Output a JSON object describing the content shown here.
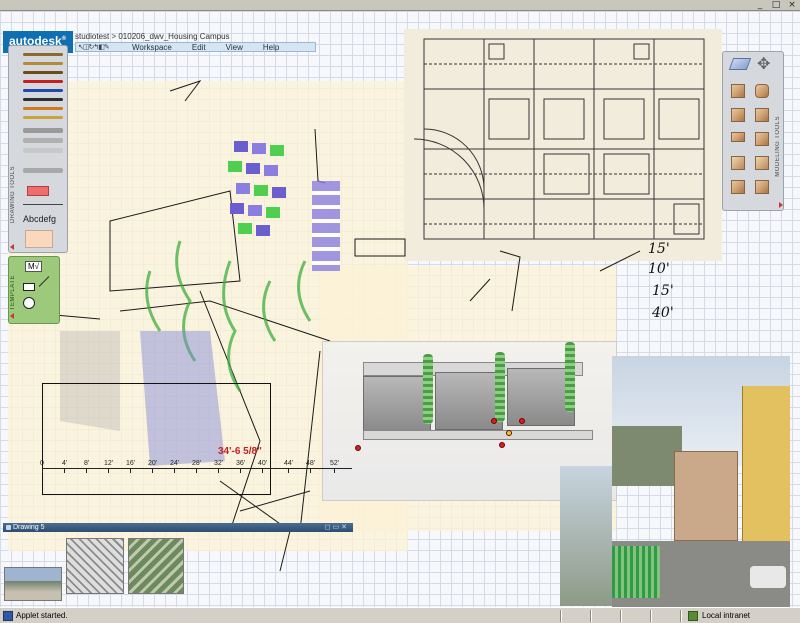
{
  "window": {
    "controls": [
      "_",
      "□",
      "×"
    ]
  },
  "app": {
    "logo": "autodesk",
    "logo_mark": "®",
    "breadcrumb": "studiotest > 010206_dwv_Housing Campus",
    "toolbar_icons": "↖◫↻↰◧✎",
    "menu": [
      "Workspace",
      "Edit",
      "View",
      "Help"
    ]
  },
  "drawing_tools": {
    "label": "DRAWING TOOLS",
    "text_sample": "Abcdefg",
    "pen_colors": [
      "#8b6b2e",
      "#b38a3b",
      "#6e4a1c",
      "#c81f1f",
      "#2448a8",
      "#2e2e2e",
      "#d07a1f",
      "#caa23e",
      "#9a9a9a",
      "#b0b0b0",
      "#c8c8c8",
      "#d8d8d8",
      "#a8a8a8"
    ],
    "eraser_color": "#f06d6d",
    "paper_color": "#fad8bd"
  },
  "template": {
    "label": "TEMPLATE",
    "sample": "M√"
  },
  "modeling_tools": {
    "label": "MODELING TOOLS"
  },
  "ruler": {
    "dimension": "34'-6 5/8\"",
    "ticks": [
      "0",
      "4'",
      "8'",
      "12'",
      "16'",
      "20'",
      "24'",
      "28'",
      "32'",
      "36'",
      "40'",
      "44'",
      "48'",
      "52'"
    ]
  },
  "handwriting": {
    "a": "15'",
    "b": "10'",
    "c": "15'",
    "d": "40'"
  },
  "drawing_strip": {
    "title": "Drawing 5",
    "controls": "◻▭✕"
  },
  "status": {
    "left": "Applet started.",
    "right": "Local intranet"
  }
}
